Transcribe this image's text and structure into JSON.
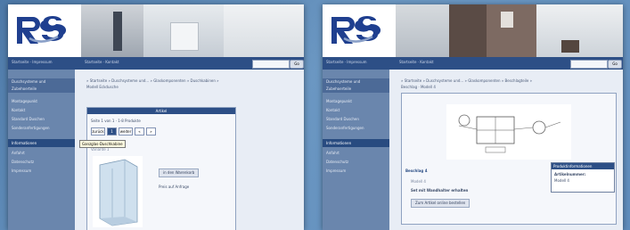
{
  "screens": [
    {
      "nav_left": "Startseite · Impressum",
      "nav_center": "Startseite · Kontakt",
      "search_placeholder": "",
      "go_label": "Go",
      "sidebar": {
        "items": [
          "Duschsysteme und",
          "Zubehoerteile",
          "Montagepunkt",
          "Kontakt",
          "Standard Duschen",
          "Sonderanfertigungen"
        ],
        "section_head": "Informationen",
        "sub_items": [
          "Anfahrt",
          "Datenschutz",
          "Impressum"
        ]
      },
      "crumb": "» Startseite » Duschsysteme und... » Glaskomponenten » Duschkabinen »",
      "crumb2": "Modell Eckdusche",
      "panel": {
        "title": "Artikel",
        "results": "Seite 1 von 1 · 1-8 Produkte",
        "pages": [
          "zurück",
          "1",
          "weiter",
          "«",
          "»"
        ],
        "product_title": "Modell 1",
        "product_sub": "Variante 1",
        "button": "in den Warenkorb",
        "price_text": "Preis auf Anfrage"
      },
      "tooltip": "Ganzglas-Duschkabine"
    },
    {
      "nav_left": "Startseite · Impressum",
      "nav_center": "Startseite · Kontakt",
      "search_placeholder": "",
      "go_label": "Go",
      "sidebar": {
        "items": [
          "Duschsysteme und",
          "Zubehoerteile",
          "Montagepunkt",
          "Kontakt",
          "Standard Duschen",
          "Sonderanfertigungen"
        ],
        "section_head": "Informationen",
        "sub_items": [
          "Anfahrt",
          "Datenschutz",
          "Impressum"
        ]
      },
      "crumb": "» Startseite » Duschsysteme und... » Glaskomponenten » Beschlagteile »",
      "crumb2": "Beschlag · Modell 4",
      "detail": {
        "title": "Beschlag 4",
        "sub": "Modell 4",
        "bold_text": "Set mit Wandhalter erhalten",
        "button": "Zum Artikel online bestellen"
      },
      "side_box": {
        "title": "Produktinformationen",
        "label": "Artikelnummer:",
        "value": "Modell 4"
      }
    }
  ]
}
